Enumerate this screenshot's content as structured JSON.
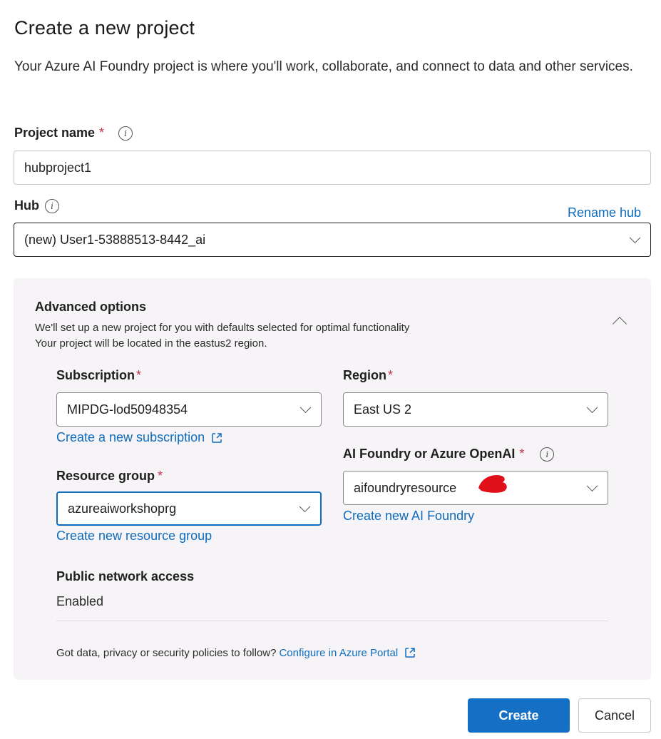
{
  "header": {
    "title": "Create a new project",
    "description": "Your Azure AI Foundry project is where you'll work, collaborate, and connect to data and other services."
  },
  "project_name": {
    "label": "Project name",
    "required_mark": "*",
    "value": "hubproject1"
  },
  "hub": {
    "label": "Hub",
    "rename_link": "Rename hub",
    "selected": "(new) User1-53888513-8442_ai"
  },
  "advanced": {
    "title": "Advanced options",
    "subtitle_line1": "We'll set up a new project for you with defaults selected for optimal functionality",
    "subtitle_line2": "Your project will be located in the eastus2 region.",
    "subscription": {
      "label": "Subscription",
      "required_mark": "*",
      "selected": "MIPDG-lod50948354",
      "create_link": "Create a new subscription"
    },
    "region": {
      "label": "Region",
      "required_mark": "*",
      "selected": "East US 2"
    },
    "ai_resource": {
      "label": "AI Foundry or Azure OpenAI",
      "required_mark": "*",
      "selected": "aifoundryresource",
      "create_link": "Create new AI Foundry"
    },
    "resource_group": {
      "label": "Resource group",
      "required_mark": "*",
      "selected": "azureaiworkshoprg",
      "create_link": "Create new resource group"
    },
    "network": {
      "label": "Public network access",
      "value": "Enabled"
    },
    "policy": {
      "text": "Got data, privacy or security policies to follow?",
      "link": "Configure in Azure Portal"
    }
  },
  "actions": {
    "create": "Create",
    "cancel": "Cancel"
  },
  "colors": {
    "accent": "#1570c5",
    "link": "#0f6cbd",
    "required": "#c4314b",
    "panel_bg": "#f6f4f6",
    "redaction": "#e0101a"
  },
  "icons": [
    "info-icon",
    "chevron-down-icon",
    "chevron-up-icon",
    "external-link-icon"
  ]
}
